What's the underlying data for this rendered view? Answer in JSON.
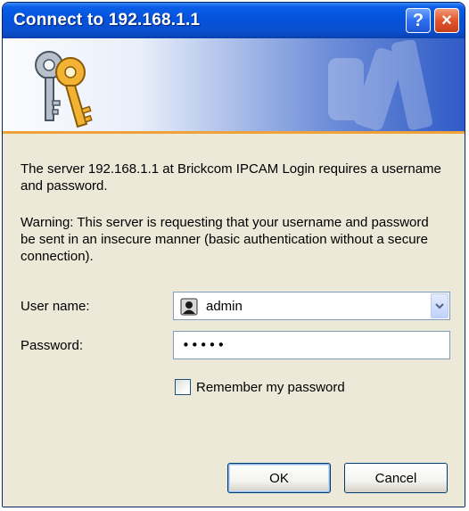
{
  "window": {
    "title": "Connect to 192.168.1.1",
    "help_label": "?",
    "close_label": "×"
  },
  "banner": {
    "icon": "keys-icon",
    "accent_color": "#f0a23a"
  },
  "message": {
    "line1": "The server 192.168.1.1 at Brickcom IPCAM Login requires a username and password.",
    "warning": "Warning: This server is requesting that your username and password be sent in an insecure manner (basic authentication without a secure connection)."
  },
  "form": {
    "username_label": "User name:",
    "username_value": "admin",
    "username_icon": "user-icon",
    "password_label": "Password:",
    "password_value": "•••••",
    "remember_label": "Remember my password",
    "remember_checked": false
  },
  "buttons": {
    "ok_label": "OK",
    "cancel_label": "Cancel"
  }
}
